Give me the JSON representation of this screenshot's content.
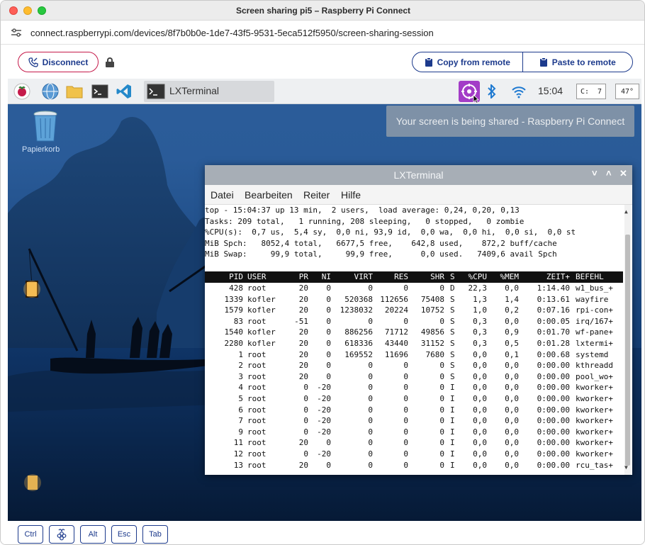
{
  "window": {
    "title": "Screen sharing pi5 – Raspberry Pi Connect"
  },
  "address": {
    "url": "connect.raspberrypi.com/devices/8f7b0b0e-1de7-43f5-9531-5eca512f5950/screen-sharing-session"
  },
  "actions": {
    "disconnect": "Disconnect",
    "copy": "Copy from remote",
    "paste": "Paste to remote"
  },
  "taskbar": {
    "window_label": "LXTerminal",
    "time": "15:04",
    "cpu": "C:  7",
    "temp": "47°"
  },
  "desktop": {
    "trash_label": "Papierkorb",
    "toast": "Your screen is being shared - Raspberry Pi Connect"
  },
  "terminal": {
    "title": "LXTerminal",
    "menu": [
      "Datei",
      "Bearbeiten",
      "Reiter",
      "Hilfe"
    ],
    "summary": [
      "top - 15:04:37 up 13 min,  2 users,  load average: 0,24, 0,20, 0,13",
      "Tasks: 209 total,   1 running, 208 sleeping,   0 stopped,   0 zombie",
      "%CPU(s):  0,7 us,  5,4 sy,  0,0 ni, 93,9 id,  0,0 wa,  0,0 hi,  0,0 si,  0,0 st",
      "MiB Spch:   8052,4 total,   6677,5 free,    642,8 used,    872,2 buff/cache",
      "MiB Swap:     99,9 total,     99,9 free,      0,0 used.   7409,6 avail Spch"
    ],
    "columns": [
      "PID",
      "USER",
      "PR",
      "NI",
      "VIRT",
      "RES",
      "SHR",
      "S",
      "%CPU",
      "%MEM",
      "ZEIT+",
      "BEFEHL"
    ],
    "rows": [
      [
        "428",
        "root",
        "20",
        "0",
        "0",
        "0",
        "0",
        "D",
        "22,3",
        "0,0",
        "1:14.40",
        "w1_bus_+"
      ],
      [
        "1339",
        "kofler",
        "20",
        "0",
        "520368",
        "112656",
        "75408",
        "S",
        "1,3",
        "1,4",
        "0:13.61",
        "wayfire"
      ],
      [
        "1579",
        "kofler",
        "20",
        "0",
        "1238032",
        "20224",
        "10752",
        "S",
        "1,0",
        "0,2",
        "0:07.16",
        "rpi-con+"
      ],
      [
        "83",
        "root",
        "-51",
        "0",
        "0",
        "0",
        "0",
        "S",
        "0,3",
        "0,0",
        "0:00.05",
        "irq/167+"
      ],
      [
        "1540",
        "kofler",
        "20",
        "0",
        "886256",
        "71712",
        "49856",
        "S",
        "0,3",
        "0,9",
        "0:01.70",
        "wf-pane+"
      ],
      [
        "2280",
        "kofler",
        "20",
        "0",
        "618336",
        "43440",
        "31152",
        "S",
        "0,3",
        "0,5",
        "0:01.28",
        "lxtermi+"
      ],
      [
        "1",
        "root",
        "20",
        "0",
        "169552",
        "11696",
        "7680",
        "S",
        "0,0",
        "0,1",
        "0:00.68",
        "systemd"
      ],
      [
        "2",
        "root",
        "20",
        "0",
        "0",
        "0",
        "0",
        "S",
        "0,0",
        "0,0",
        "0:00.00",
        "kthreadd"
      ],
      [
        "3",
        "root",
        "20",
        "0",
        "0",
        "0",
        "0",
        "S",
        "0,0",
        "0,0",
        "0:00.00",
        "pool_wo+"
      ],
      [
        "4",
        "root",
        "0",
        "-20",
        "0",
        "0",
        "0",
        "I",
        "0,0",
        "0,0",
        "0:00.00",
        "kworker+"
      ],
      [
        "5",
        "root",
        "0",
        "-20",
        "0",
        "0",
        "0",
        "I",
        "0,0",
        "0,0",
        "0:00.00",
        "kworker+"
      ],
      [
        "6",
        "root",
        "0",
        "-20",
        "0",
        "0",
        "0",
        "I",
        "0,0",
        "0,0",
        "0:00.00",
        "kworker+"
      ],
      [
        "7",
        "root",
        "0",
        "-20",
        "0",
        "0",
        "0",
        "I",
        "0,0",
        "0,0",
        "0:00.00",
        "kworker+"
      ],
      [
        "9",
        "root",
        "0",
        "-20",
        "0",
        "0",
        "0",
        "I",
        "0,0",
        "0,0",
        "0:00.00",
        "kworker+"
      ],
      [
        "11",
        "root",
        "20",
        "0",
        "0",
        "0",
        "0",
        "I",
        "0,0",
        "0,0",
        "0:00.00",
        "kworker+"
      ],
      [
        "12",
        "root",
        "0",
        "-20",
        "0",
        "0",
        "0",
        "I",
        "0,0",
        "0,0",
        "0:00.00",
        "kworker+"
      ],
      [
        "13",
        "root",
        "20",
        "0",
        "0",
        "0",
        "0",
        "I",
        "0,0",
        "0,0",
        "0:00.00",
        "rcu_tas+"
      ]
    ]
  },
  "keys": [
    "Ctrl",
    "Alt",
    "Esc",
    "Tab"
  ],
  "colors": {
    "accent": "#1c3a8c",
    "raspberry": "#c51a4a"
  }
}
